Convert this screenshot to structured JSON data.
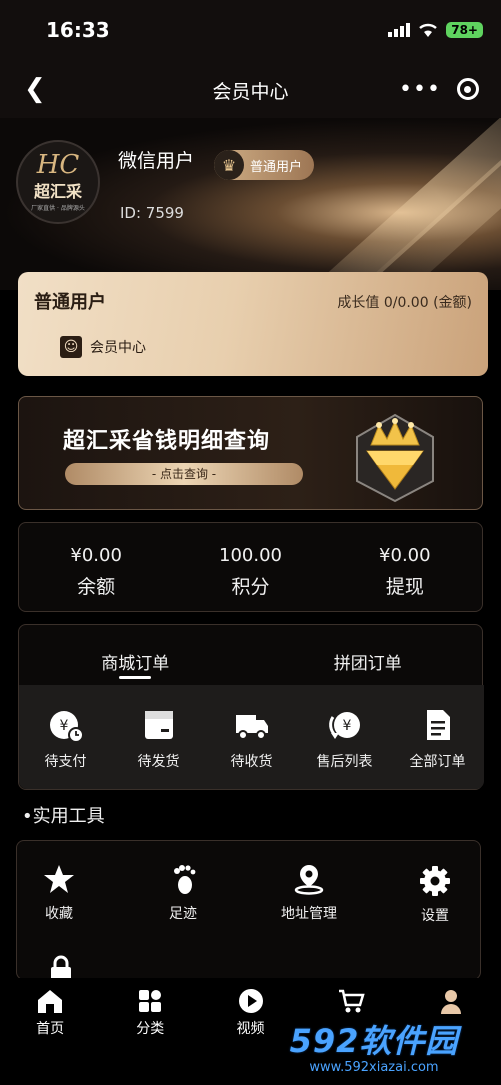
{
  "status_bar": {
    "time": "16:33",
    "battery": "78+"
  },
  "nav": {
    "title": "会员中心",
    "more": "•••"
  },
  "profile": {
    "logo_hc": "HC",
    "logo_name": "超汇采",
    "logo_tagline": "厂家直供 · 品牌源头",
    "username": "微信用户",
    "level_badge": "普通用户",
    "id_label": "ID: 7599"
  },
  "member_card": {
    "title": "普通用户",
    "growth": "成长值 0/0.00 (金额)",
    "link": "会员中心"
  },
  "banner": {
    "title": "超汇采省钱明细查询",
    "button": "- 点击查询 -"
  },
  "balance": [
    {
      "value": "¥0.00",
      "label": "余额"
    },
    {
      "value": "100.00",
      "label": "积分"
    },
    {
      "value": "¥0.00",
      "label": "提现"
    }
  ],
  "orders": {
    "tabs": [
      "商城订单",
      "拼团订单"
    ],
    "active_tab": "商城订单",
    "items": [
      {
        "label": "待支付",
        "icon": "pending-payment-icon"
      },
      {
        "label": "待发货",
        "icon": "box-icon"
      },
      {
        "label": "待收货",
        "icon": "truck-icon"
      },
      {
        "label": "售后列表",
        "icon": "refund-icon"
      },
      {
        "label": "全部订单",
        "icon": "document-icon"
      }
    ]
  },
  "tools": {
    "heading": "•实用工具",
    "items": [
      {
        "label": "收藏",
        "icon": "star-icon"
      },
      {
        "label": "足迹",
        "icon": "footprint-icon"
      },
      {
        "label": "地址管理",
        "icon": "location-icon"
      },
      {
        "label": "设置",
        "icon": "gear-icon"
      },
      {
        "label": "",
        "icon": "lock-icon"
      }
    ]
  },
  "tab_bar": [
    {
      "label": "首页",
      "icon": "home-icon"
    },
    {
      "label": "分类",
      "icon": "category-icon"
    },
    {
      "label": "视频",
      "icon": "play-icon"
    },
    {
      "label": "",
      "icon": "cart-icon"
    },
    {
      "label": "",
      "icon": "profile-icon"
    }
  ],
  "watermark": {
    "main": "592软件园",
    "url": "www.592xiazai.com"
  },
  "colors": {
    "gold": "#d8b680",
    "card_bg": "#e8cfae",
    "panel_bg": "#0b0908"
  }
}
